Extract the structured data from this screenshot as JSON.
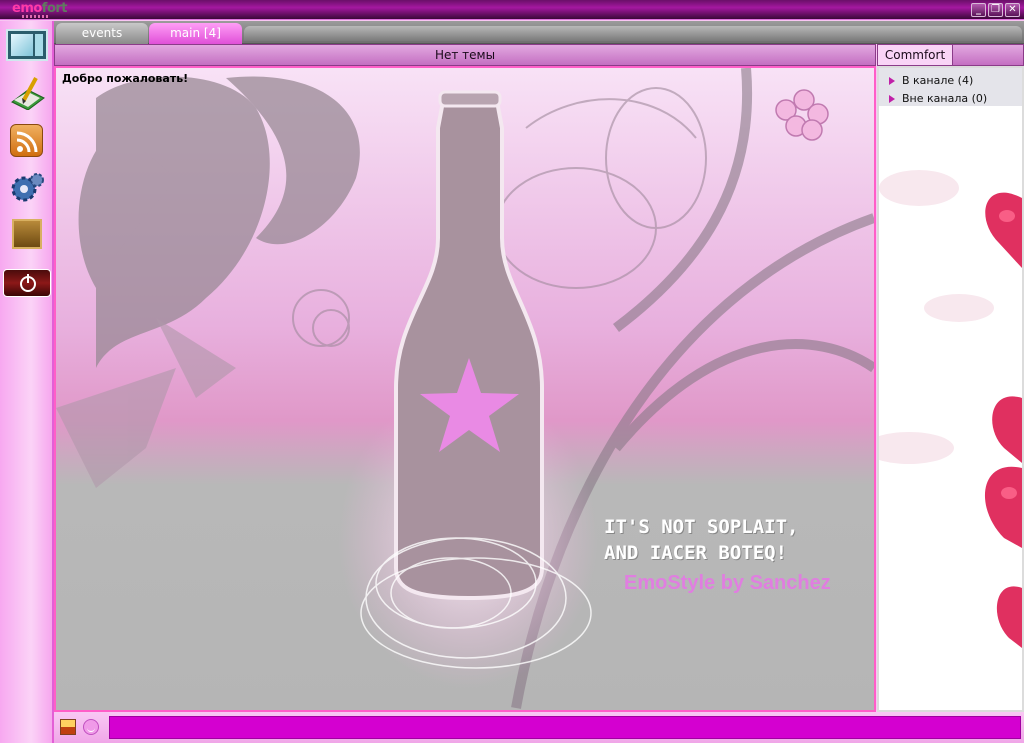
{
  "app": {
    "logo_part1": "emo",
    "logo_part2": "fort"
  },
  "window_controls": {
    "minimize": "_",
    "restore": "❐",
    "close": "✕"
  },
  "tabs": [
    {
      "label": "events"
    },
    {
      "label": "main [4]"
    }
  ],
  "topic": "Нет темы",
  "userlist": {
    "tab_label": "Commfort",
    "items": [
      {
        "label": "В канале (4)"
      },
      {
        "label": "Вне канала (0)"
      }
    ]
  },
  "chat": {
    "welcome": "Добро пожаловать!",
    "quote_line1": "IT'S NOT SOPLAIT,",
    "quote_line2": "AND IACER BOTEQ!",
    "credit": "EmoStyle by Sanchez"
  },
  "input": {
    "value": ""
  },
  "colors": {
    "accent": "#d400d0",
    "tab_active": "#e050d8",
    "titlebar": "#a418a0"
  },
  "icons": {
    "toolbar": [
      "window-icon",
      "pen-icon",
      "rss-icon",
      "gear-icon",
      "folder-icon",
      "power-icon"
    ],
    "bottom": [
      "image-icon",
      "smiley-icon"
    ]
  }
}
